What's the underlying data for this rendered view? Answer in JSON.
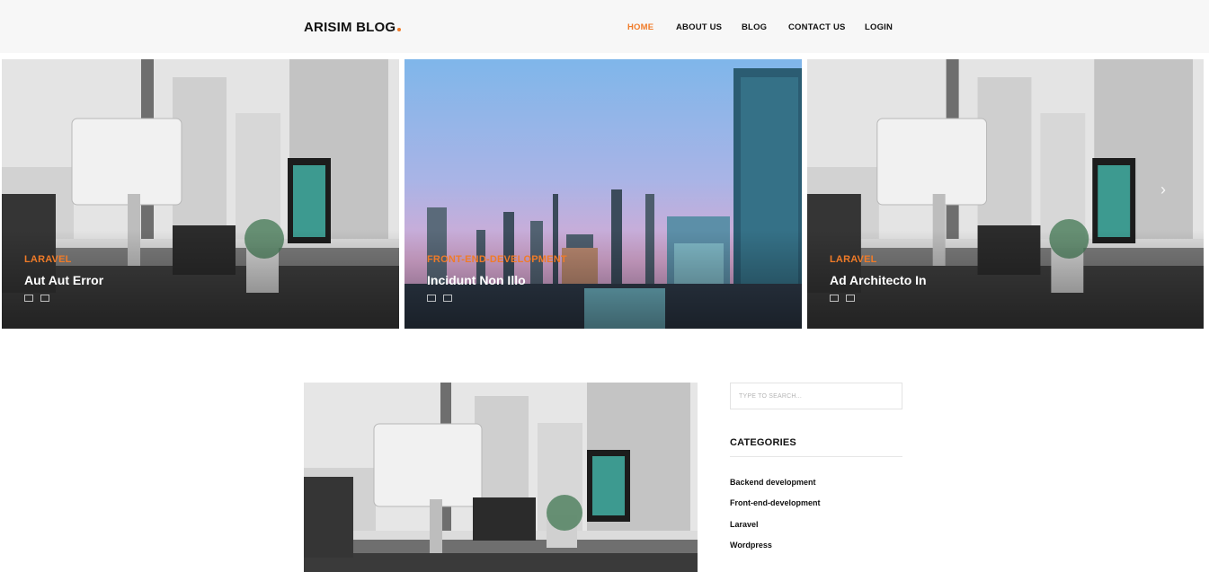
{
  "header": {
    "brand": "ARISIM BLOG",
    "nav": {
      "home": "HOME",
      "about": "ABOUT US",
      "blog": "BLOG",
      "contact": "CONTACT US",
      "login": "LOGIN"
    }
  },
  "slider": {
    "slides": [
      {
        "category": "LARAVEL",
        "title": "Aut Aut Error"
      },
      {
        "category": "FRONT-END-DEVELOPMENT",
        "title": "Incidunt Non Illo"
      },
      {
        "category": "LARAVEL",
        "title": "Ad Architecto In"
      }
    ],
    "prev_icon": "chevron-left-icon",
    "next_icon": "chevron-right-icon",
    "next_glyph": "›"
  },
  "sidebar": {
    "search": {
      "placeholder": "TYPE TO SEARCH..."
    },
    "categories": {
      "title": "CATEGORIES",
      "items": [
        "Backend development",
        "Front-end-development",
        "Laravel",
        "Wordpress"
      ]
    }
  },
  "colors": {
    "accent": "#f07b28",
    "header_bg": "#f7f7f7"
  }
}
